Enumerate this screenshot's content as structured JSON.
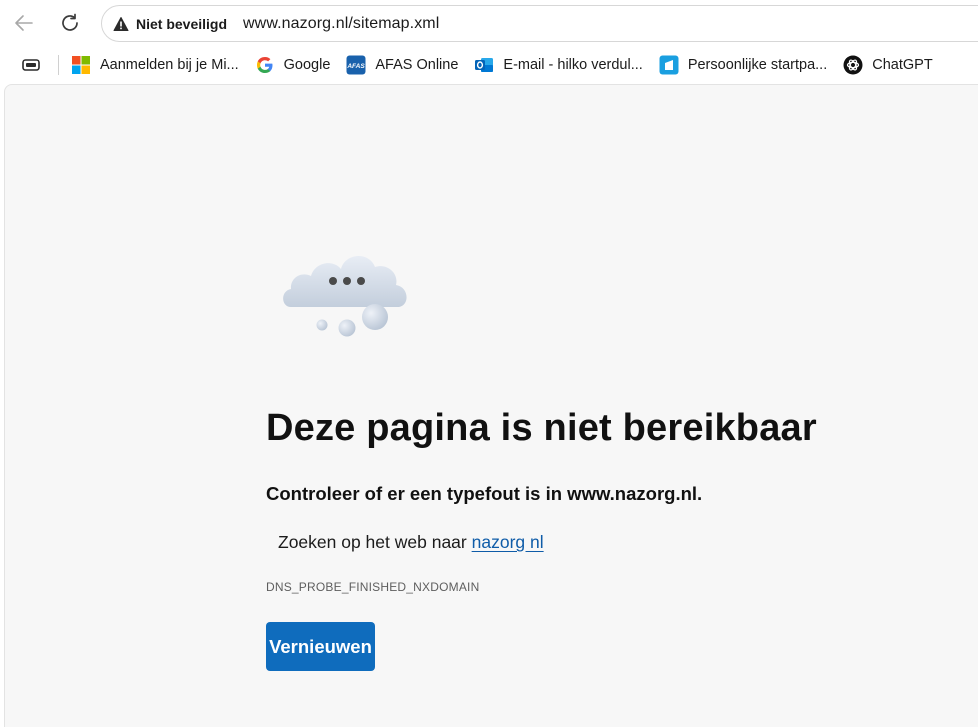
{
  "toolbar": {
    "security_label": "Niet beveiligd",
    "url": "www.nazorg.nl/sitemap.xml"
  },
  "bookmarks": [
    {
      "label": "Aanmelden bij je Mi...",
      "icon": "microsoft-icon"
    },
    {
      "label": "Google",
      "icon": "google-icon"
    },
    {
      "label": "AFAS Online",
      "icon": "afas-icon"
    },
    {
      "label": "E-mail - hilko verdul...",
      "icon": "outlook-icon"
    },
    {
      "label": "Persoonlijke startpa...",
      "icon": "startpage-icon"
    },
    {
      "label": "ChatGPT",
      "icon": "chatgpt-icon"
    }
  ],
  "error_page": {
    "title": "Deze pagina is niet bereikbaar",
    "subtitle": "Controleer of er een typefout is in www.nazorg.nl.",
    "search_prefix": "Zoeken op het web naar",
    "search_link": "nazorg nl",
    "error_code": "DNS_PROBE_FINISHED_NXDOMAIN",
    "reload_label": "Vernieuwen"
  },
  "colors": {
    "accent": "#0f6cbd",
    "link": "#0f5ca8",
    "page_bg": "#f7f7f7"
  },
  "afas_icon_text": "AFAS"
}
